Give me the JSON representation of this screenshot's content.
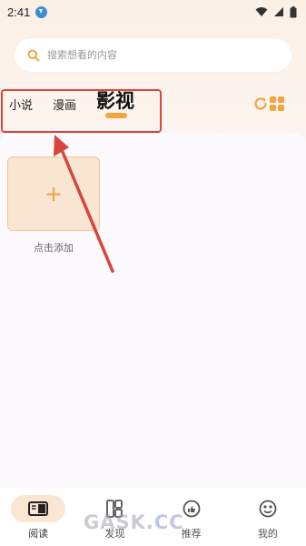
{
  "status_bar": {
    "time": "2:41"
  },
  "search": {
    "placeholder": "搜索想看的内容"
  },
  "tabs": [
    {
      "label": "小说",
      "active": false
    },
    {
      "label": "漫画",
      "active": false
    },
    {
      "label": "影视",
      "active": true
    }
  ],
  "add_card": {
    "plus": "+",
    "label": "点击添加"
  },
  "bottom_nav": [
    {
      "label": "阅读",
      "icon": "book-icon",
      "active": true
    },
    {
      "label": "发现",
      "icon": "discover-icon",
      "active": false
    },
    {
      "label": "推荐",
      "icon": "thumbs-up-icon",
      "active": false
    },
    {
      "label": "我的",
      "icon": "profile-icon",
      "active": false
    }
  ],
  "watermark": {
    "text": "GASK.",
    "cc": "CC"
  },
  "colors": {
    "accent": "#f2a541",
    "annotation_red": "#d9453a"
  }
}
